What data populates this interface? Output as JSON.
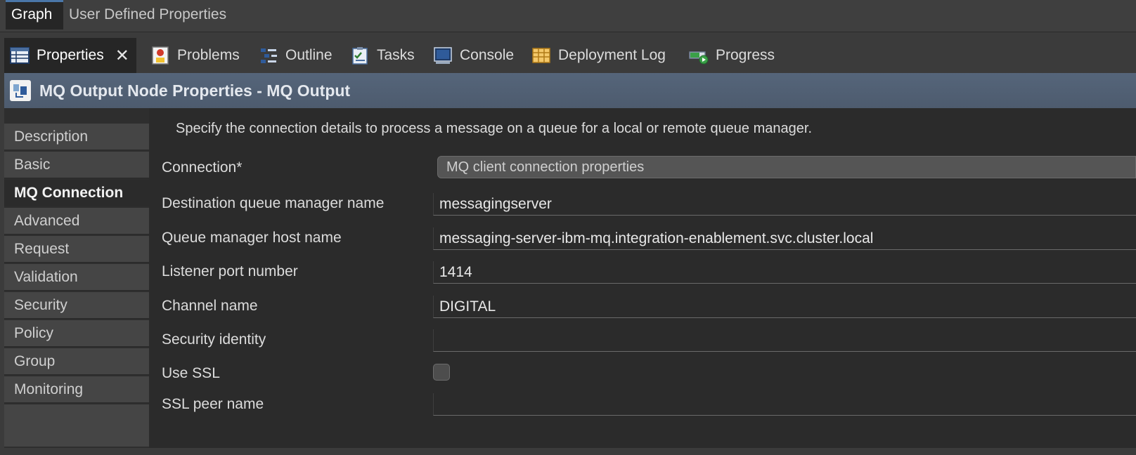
{
  "editor_tabs": [
    "Graph",
    "User Defined Properties"
  ],
  "views": [
    {
      "label": "Properties",
      "icon": "properties-table-icon"
    },
    {
      "label": "Problems",
      "icon": "problems-icon"
    },
    {
      "label": "Outline",
      "icon": "outline-icon"
    },
    {
      "label": "Tasks",
      "icon": "tasks-icon"
    },
    {
      "label": "Console",
      "icon": "console-icon"
    },
    {
      "label": "Deployment Log",
      "icon": "deployment-log-icon"
    },
    {
      "label": "Progress",
      "icon": "progress-icon"
    }
  ],
  "title": "MQ Output Node Properties - MQ Output",
  "nav": [
    "Description",
    "Basic",
    "MQ Connection",
    "Advanced",
    "Request",
    "Validation",
    "Security",
    "Policy",
    "Group",
    "Monitoring"
  ],
  "active_nav": "MQ Connection",
  "form": {
    "description": "Specify the connection details to process a message on a queue for a local or remote queue manager.",
    "connection_label": "Connection*",
    "connection_value": "MQ client connection properties",
    "dest_qm_label": "Destination queue manager name",
    "dest_qm_value": "messagingserver",
    "qm_host_label": "Queue manager host name",
    "qm_host_value": "messaging-server-ibm-mq.integration-enablement.svc.cluster.local",
    "port_label": "Listener port number",
    "port_value": "1414",
    "channel_label": "Channel name",
    "channel_value": "DIGITAL",
    "security_identity_label": "Security identity",
    "security_identity_value": "",
    "use_ssl_label": "Use SSL",
    "use_ssl_checked": false,
    "ssl_peer_label": "SSL peer name",
    "ssl_peer_value": ""
  },
  "colors": {
    "accent": "#4a76a8",
    "title_bar": "#55657a",
    "panel_bg": "#2b2b2b"
  }
}
